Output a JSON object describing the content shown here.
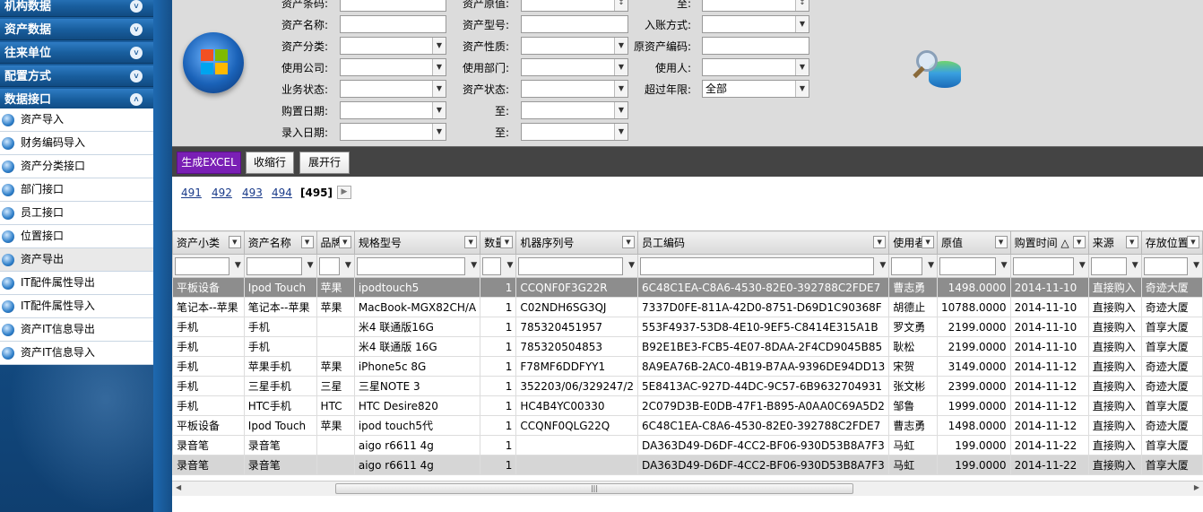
{
  "sidebar": {
    "sections": [
      {
        "label": "机构数据",
        "icon": "chevron-down-icon"
      },
      {
        "label": "资产数据",
        "icon": "chevron-down-icon"
      },
      {
        "label": "往来单位",
        "icon": "chevron-down-icon"
      },
      {
        "label": "配置方式",
        "icon": "chevron-down-icon"
      },
      {
        "label": "数据接口",
        "icon": "chevron-up-icon"
      }
    ],
    "items": [
      {
        "label": "资产导入"
      },
      {
        "label": "财务编码导入"
      },
      {
        "label": "资产分类接口"
      },
      {
        "label": "部门接口"
      },
      {
        "label": "员工接口"
      },
      {
        "label": "位置接口"
      },
      {
        "label": "资产导出"
      },
      {
        "label": "IT配件属性导出"
      },
      {
        "label": "IT配件属性导入"
      },
      {
        "label": "资产IT信息导出"
      },
      {
        "label": "资产IT信息导入"
      }
    ]
  },
  "filters": {
    "col1": [
      "资产条码:",
      "资产名称:",
      "资产分类:",
      "使用公司:",
      "业务状态:",
      "购置日期:",
      "录入日期:"
    ],
    "col2": [
      "资产原值:",
      "资产型号:",
      "资产性质:",
      "使用部门:",
      "资产状态:",
      "至:",
      "至:"
    ],
    "col3": [
      "至:",
      "入账方式:",
      "原资产编码:",
      "使用人:",
      "超过年限:"
    ],
    "over_years_value": "全部"
  },
  "toolbar": {
    "excel_label": "生成EXCEL",
    "collapse_label": "收缩行",
    "expand_label": "展开行"
  },
  "pager": {
    "pages": [
      "491",
      "492",
      "493",
      "494"
    ],
    "current": "[495]"
  },
  "table": {
    "columns": [
      "资产小类",
      "资产名称",
      "品牌",
      "规格型号",
      "数量",
      "机器序列号",
      "员工编码",
      "使用者",
      "原值",
      "购置时间 △",
      "来源",
      "存放位置"
    ],
    "rows": [
      [
        "平板设备",
        "Ipod Touch",
        "苹果",
        "ipodtouch5",
        "1",
        "CCQNF0F3G22R",
        "6C48C1EA-C8A6-4530-82E0-392788C2FDE7",
        "曹志勇",
        "1498.0000",
        "2014-11-10",
        "直接购入",
        "奇迹大厦"
      ],
      [
        "笔记本--苹果",
        "笔记本--苹果",
        "苹果",
        "MacBook-MGX82CH/A",
        "1",
        "C02NDH6SG3QJ",
        "7337D0FE-811A-42D0-8751-D69D1C90368F",
        "胡德止",
        "10788.0000",
        "2014-11-10",
        "直接购入",
        "奇迹大厦"
      ],
      [
        "手机",
        "手机",
        "",
        "米4 联通版16G",
        "1",
        "785320451957",
        "553F4937-53D8-4E10-9EF5-C8414E315A1B",
        "罗文勇",
        "2199.0000",
        "2014-11-10",
        "直接购入",
        "首享大厦"
      ],
      [
        "手机",
        "手机",
        "",
        "米4 联通版 16G",
        "1",
        "785320504853",
        "B92E1BE3-FCB5-4E07-8DAA-2F4CD9045B85",
        "耿松",
        "2199.0000",
        "2014-11-10",
        "直接购入",
        "首享大厦"
      ],
      [
        "手机",
        "苹果手机",
        "苹果",
        "iPhone5c 8G",
        "1",
        "F78MF6DDFYY1",
        "8A9EA76B-2AC0-4B19-B7AA-9396DE94DD13",
        "宋贺",
        "3149.0000",
        "2014-11-12",
        "直接购入",
        "奇迹大厦"
      ],
      [
        "手机",
        "三星手机",
        "三星",
        "三星NOTE 3",
        "1",
        "352203/06/329247/2",
        "5E8413AC-927D-44DC-9C57-6B9632704931",
        "张文彬",
        "2399.0000",
        "2014-11-12",
        "直接购入",
        "奇迹大厦"
      ],
      [
        "手机",
        "HTC手机",
        "HTC",
        "HTC Desire820",
        "1",
        "HC4B4YC00330",
        "2C079D3B-E0DB-47F1-B895-A0AA0C69A5D2",
        "邹鲁",
        "1999.0000",
        "2014-11-12",
        "直接购入",
        "首享大厦"
      ],
      [
        "平板设备",
        "Ipod Touch",
        "苹果",
        "ipod touch5代",
        "1",
        "CCQNF0QLG22Q",
        "6C48C1EA-C8A6-4530-82E0-392788C2FDE7",
        "曹志勇",
        "1498.0000",
        "2014-11-12",
        "直接购入",
        "奇迹大厦"
      ],
      [
        "录音笔",
        "录音笔",
        "",
        "aigo r6611 4g",
        "1",
        "",
        "DA363D49-D6DF-4CC2-BF06-930D53B8A7F3",
        "马虹",
        "199.0000",
        "2014-11-22",
        "直接购入",
        "首享大厦"
      ],
      [
        "录音笔",
        "录音笔",
        "",
        "aigo r6611 4g",
        "1",
        "",
        "DA363D49-D6DF-4CC2-BF06-930D53B8A7F3",
        "马虹",
        "199.0000",
        "2014-11-22",
        "直接购入",
        "首享大厦"
      ]
    ]
  },
  "colors": {
    "excel_button": "#7a1fb5",
    "selected_row": "#8d8d8d",
    "sidebar": "#1a5fa0"
  }
}
